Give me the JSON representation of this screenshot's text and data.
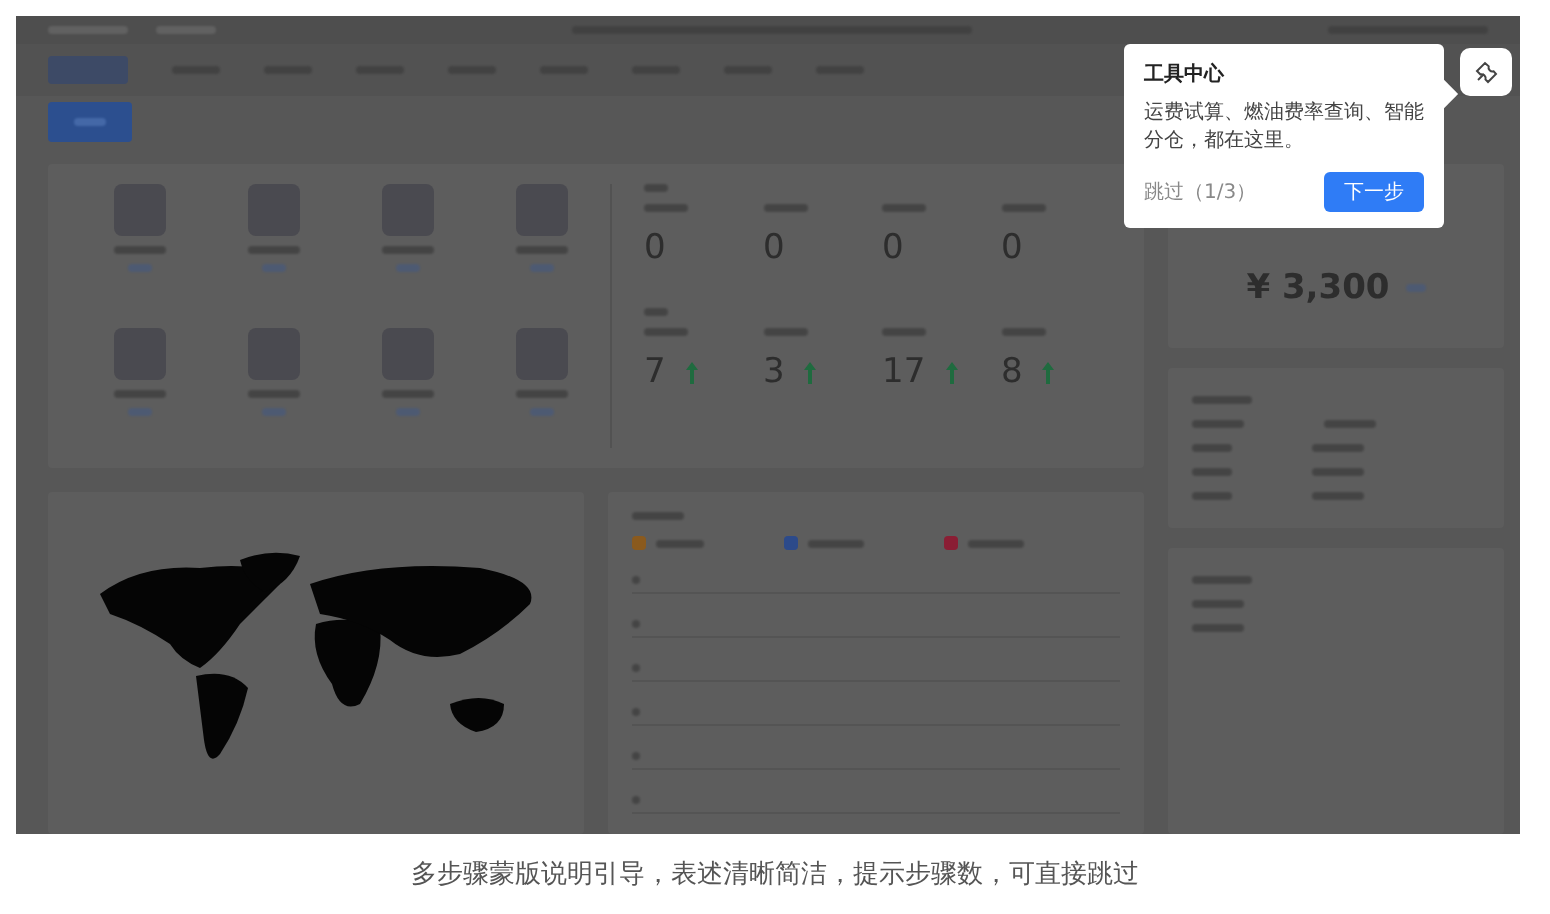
{
  "tooltip": {
    "title": "工具中心",
    "body": "运费试算、燃油费率查询、智能分仓，都在这里。",
    "skip": "跳过（1/3）",
    "next": "下一步"
  },
  "stats": {
    "today": [
      "0",
      "0",
      "0",
      "0"
    ],
    "yesterday": [
      {
        "value": "7",
        "rising": true
      },
      {
        "value": "3",
        "rising": true
      },
      {
        "value": "17",
        "rising": true
      },
      {
        "value": "8",
        "rising": true
      }
    ]
  },
  "balance": "¥ 3,300",
  "caption": "多步骤蒙版说明引导，表述清晰简洁，提示步骤数，可直接跳过"
}
